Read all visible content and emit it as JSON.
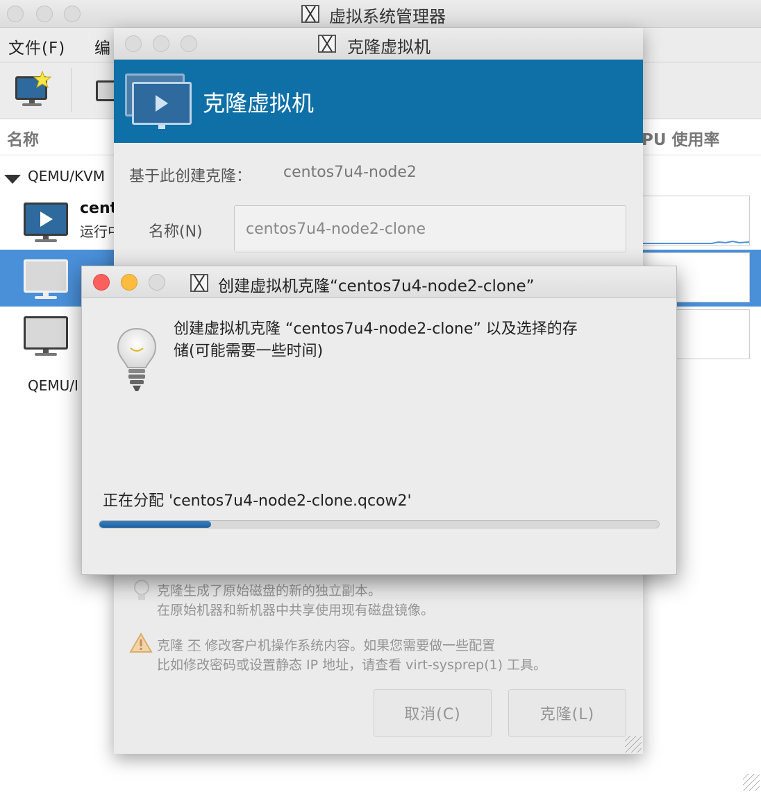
{
  "main_window": {
    "title": "虚拟系统管理器",
    "menu": {
      "file": "文件(F)",
      "edit": "编"
    },
    "columns": {
      "name": "名称",
      "cpu": "PU 使用率"
    },
    "groups": [
      {
        "label": "QEMU/KVM"
      },
      {
        "label": "QEMU/I"
      }
    ],
    "vms": [
      {
        "name": "cent",
        "status": "运行中"
      }
    ]
  },
  "clone_dialog": {
    "title": "克隆虚拟机",
    "banner_title": "克隆虚拟机",
    "source_label": "基于此创建克隆：",
    "source_value": "centos7u4-node2",
    "name_label": "名称(N)",
    "name_value": "centos7u4-node2-clone",
    "info1_line1": "克隆生成了原始磁盘的新的独立副本。",
    "info1_line2": "在原始机器和新机器中共享使用现有磁盘镜像。",
    "warn_line1_a": "克隆",
    "warn_line1_b": "不",
    "warn_line1_c": "修改客户机操作系统内容。如果您需要做一些配置",
    "warn_line2": "比如修改密码或设置静态 IP 地址，请查看 virt-sysprep(1) 工具。",
    "cancel_label": "取消(C)",
    "clone_label": "克隆(L)"
  },
  "progress_dialog": {
    "title": "创建虚拟机克隆“centos7u4-node2-clone”",
    "message_line1": "创建虚拟机克隆 “centos7u4-node2-clone” 以及选择的存",
    "message_line2": "储(可能需要一些时间)",
    "status": "正在分配 'centos7u4-node2-clone.qcow2'",
    "progress": 0.2
  },
  "colors": {
    "banner": "#0f70a8",
    "selection": "#4a90d9",
    "progress": "#2a6fb0"
  }
}
